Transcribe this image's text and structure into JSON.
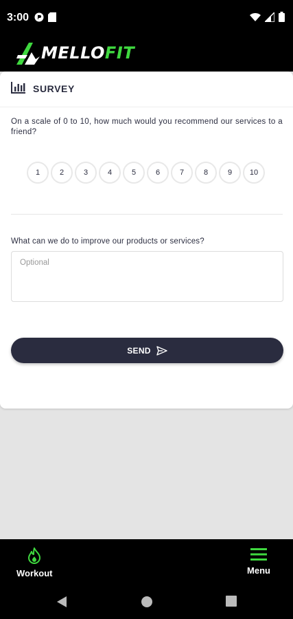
{
  "status_bar": {
    "time": "3:00",
    "icons_left": [
      "privacy-icon",
      "sd-card-icon"
    ],
    "icons_right": [
      "wifi-icon",
      "signal-icon",
      "battery-icon"
    ]
  },
  "app": {
    "logo_text_main": "MELLO",
    "logo_text_accent": "FIT",
    "accent_color": "#3fd83f",
    "dark_color": "#2a2c3f"
  },
  "survey": {
    "title": "SURVEY",
    "question_recommend": "On a scale of 0 to 10, how much would you recommend our services to a friend?",
    "ratings": [
      "1",
      "2",
      "3",
      "4",
      "5",
      "6",
      "7",
      "8",
      "9",
      "10"
    ],
    "question_improve": "What can we do to improve our products or services?",
    "improve_placeholder": "Optional",
    "improve_value": "",
    "send_label": "SEND"
  },
  "bottom_nav": {
    "items": [
      {
        "label": "Workout",
        "icon": "flame-icon"
      },
      {
        "label": "Menu",
        "icon": "hamburger-icon"
      }
    ]
  },
  "system_nav": {
    "icons": [
      "back-icon",
      "home-icon",
      "recents-icon"
    ]
  }
}
